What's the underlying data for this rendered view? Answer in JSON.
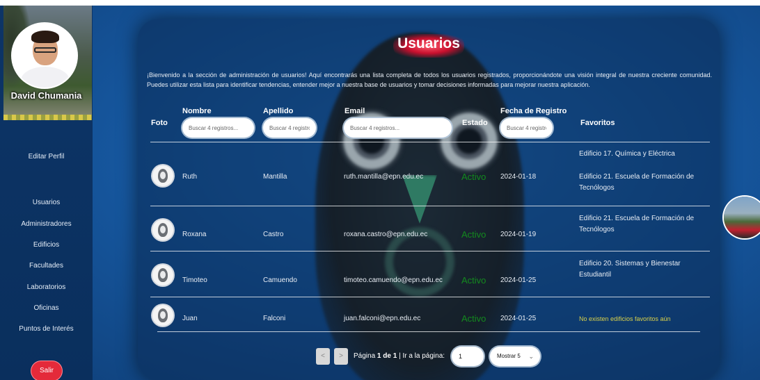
{
  "sidebar": {
    "profile_name": "David Chumania",
    "items": [
      {
        "label": "Editar Perfil"
      },
      {
        "label": "Usuarios"
      },
      {
        "label": "Administradores"
      },
      {
        "label": "Edificios"
      },
      {
        "label": "Facultades"
      },
      {
        "label": "Laboratorios"
      },
      {
        "label": "Oficinas"
      },
      {
        "label": "Puntos de Interés"
      }
    ],
    "logout_label": "Salir",
    "logout_color": "#e42a3a"
  },
  "main": {
    "title": "Usuarios",
    "intro": "¡Bienvenido a la sección de administración de usuarios! Aquí encontrarás una lista completa de todos los usuarios registrados, proporcionándote una visión integral de nuestra creciente comunidad. Puedes utilizar esta lista para identificar tendencias, entender mejor a nuestra base de usuarios y tomar decisiones informadas para mejorar nuestra aplicación.",
    "columns": {
      "foto": "Foto",
      "nombre": "Nombre",
      "apellido": "Apellido",
      "email": "Email",
      "estado": "Estado",
      "fecha": "Fecha de Registro",
      "favoritos": "Favoritos"
    },
    "search_placeholder": "Buscar 4 registros...",
    "rows": [
      {
        "nombre": "Ruth",
        "apellido": "Mantilla",
        "email": "ruth.mantilla@epn.edu.ec",
        "estado": "Activo",
        "fecha": "2024-01-18",
        "favoritos": [
          "Edificio 17. Química y Eléctrica",
          "Edificio 21. Escuela de Formación de Tecnólogos"
        ]
      },
      {
        "nombre": "Roxana",
        "apellido": "Castro",
        "email": "roxana.castro@epn.edu.ec",
        "estado": "Activo",
        "fecha": "2024-01-19",
        "favoritos": [
          "Edificio 21. Escuela de Formación de Tecnólogos"
        ]
      },
      {
        "nombre": "Timoteo",
        "apellido": "Camuendo",
        "email": "timoteo.camuendo@epn.edu.ec",
        "estado": "Activo",
        "fecha": "2024-01-25",
        "favoritos": [
          "Edificio 20. Sistemas y Bienestar Estudiantil"
        ]
      },
      {
        "nombre": "Juan",
        "apellido": "Falconi",
        "email": "juan.falconi@epn.edu.ec",
        "estado": "Activo",
        "fecha": "2024-01-25",
        "favoritos_empty": "No existen edificios favoritos aún"
      }
    ],
    "status_color": "#138a1e",
    "empty_fav_color": "#d9d14a"
  },
  "pagination": {
    "prev": "<",
    "next": ">",
    "page_label": "Página",
    "page_current": "1",
    "of_label": "de",
    "page_total": "1",
    "goto_label": "| Ir a la página:",
    "goto_value": "1",
    "show_label": "Mostrar 5"
  }
}
